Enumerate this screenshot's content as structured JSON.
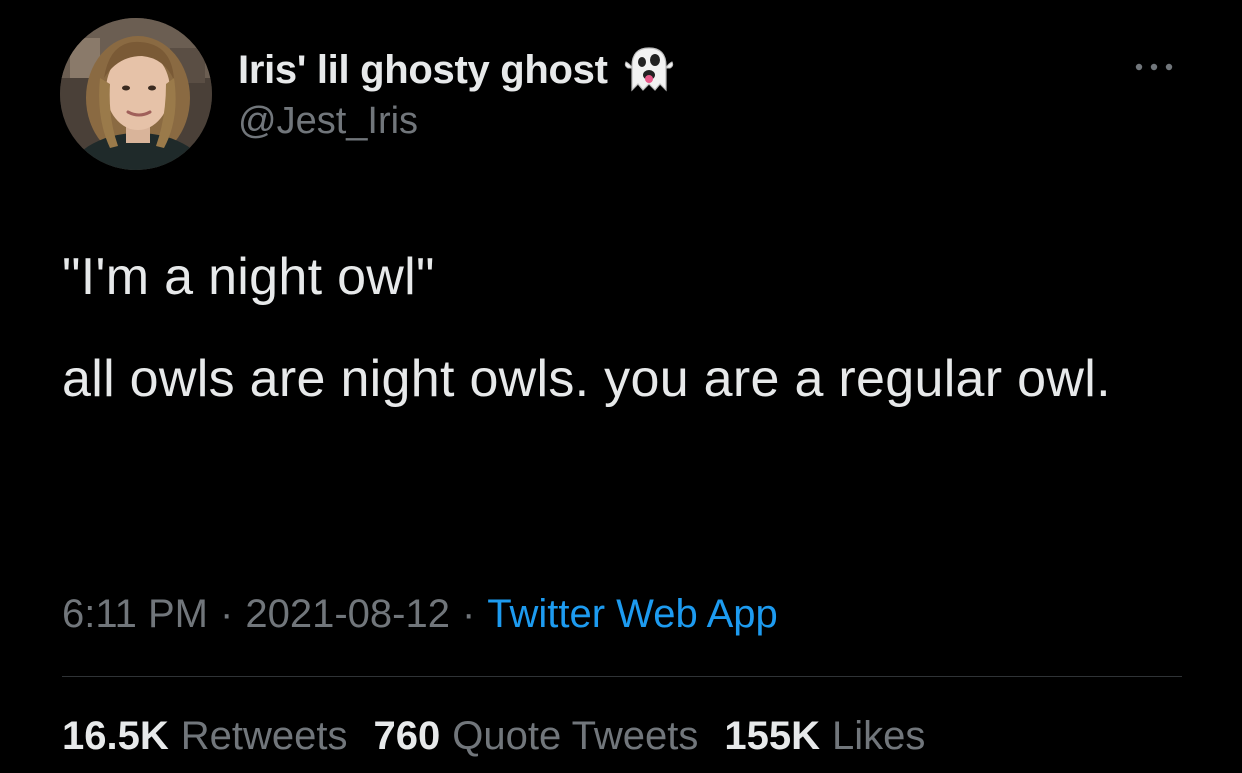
{
  "author": {
    "display_name": "Iris' lil ghosty ghost",
    "name_emoji": "ghost-emoji",
    "handle": "@Jest_Iris",
    "avatar": "profile-photo"
  },
  "more_icon": "more-horizontal-icon",
  "tweet": {
    "paragraphs": [
      "\"I'm a night owl\"",
      "all owls are night owls. you are a regular owl."
    ]
  },
  "meta": {
    "time": "6:11 PM",
    "separator": "·",
    "date": "2021-08-12",
    "source": "Twitter Web App"
  },
  "stats": {
    "retweets_count": "16.5K",
    "retweets_label": "Retweets",
    "quotes_count": "760",
    "quotes_label": "Quote Tweets",
    "likes_count": "155K",
    "likes_label": "Likes"
  },
  "colors": {
    "background": "#000000",
    "text_primary": "#e7e9ea",
    "text_secondary": "#71767b",
    "link": "#1d9bf0",
    "divider": "#2f3336"
  }
}
